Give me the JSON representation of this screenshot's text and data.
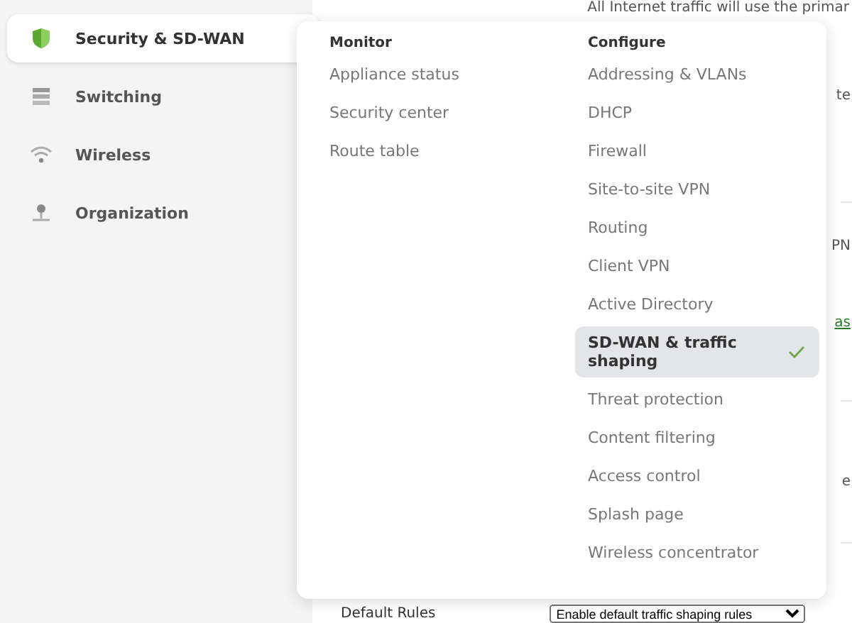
{
  "sidebar": {
    "items": [
      {
        "label": "Security & SD-WAN",
        "selected": true
      },
      {
        "label": "Switching",
        "selected": false
      },
      {
        "label": "Wireless",
        "selected": false
      },
      {
        "label": "Organization",
        "selected": false
      }
    ]
  },
  "background": {
    "top_text": "All Internet traffic will use the primar",
    "fragments": [
      {
        "text": "te",
        "kind": "text"
      },
      {
        "text": "PN",
        "kind": "text"
      },
      {
        "text": "as",
        "kind": "link"
      },
      {
        "text": "e",
        "kind": "text"
      }
    ],
    "default_rules": {
      "label": "Default Rules",
      "value": "Enable default traffic shaping rules"
    }
  },
  "menu": {
    "columns": [
      {
        "heading": "Monitor",
        "items": [
          {
            "label": "Appliance status",
            "selected": false
          },
          {
            "label": "Security center",
            "selected": false
          },
          {
            "label": "Route table",
            "selected": false
          }
        ]
      },
      {
        "heading": "Configure",
        "items": [
          {
            "label": "Addressing & VLANs",
            "selected": false
          },
          {
            "label": "DHCP",
            "selected": false
          },
          {
            "label": "Firewall",
            "selected": false
          },
          {
            "label": "Site-to-site VPN",
            "selected": false
          },
          {
            "label": "Routing",
            "selected": false
          },
          {
            "label": "Client VPN",
            "selected": false
          },
          {
            "label": "Active Directory",
            "selected": false
          },
          {
            "label": "SD-WAN & traffic shaping",
            "selected": true
          },
          {
            "label": "Threat protection",
            "selected": false
          },
          {
            "label": "Content filtering",
            "selected": false
          },
          {
            "label": "Access control",
            "selected": false
          },
          {
            "label": "Splash page",
            "selected": false
          },
          {
            "label": "Wireless concentrator",
            "selected": false
          }
        ]
      }
    ]
  }
}
